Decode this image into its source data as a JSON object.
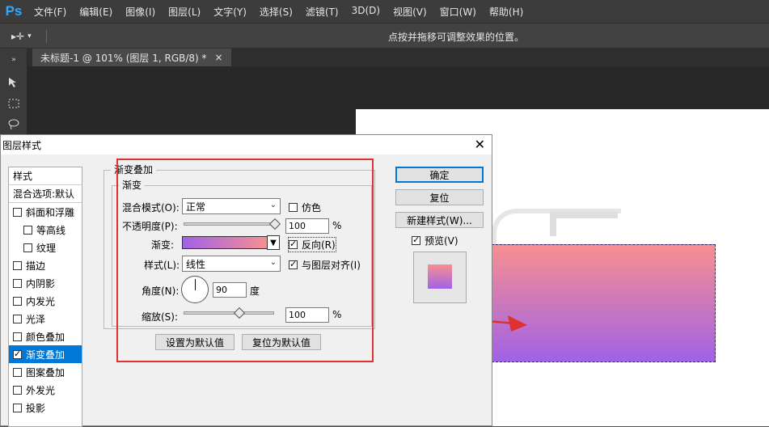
{
  "app": {
    "logo": "Ps"
  },
  "menu": [
    "文件(F)",
    "编辑(E)",
    "图像(I)",
    "图层(L)",
    "文字(Y)",
    "选择(S)",
    "滤镜(T)",
    "3D(D)",
    "视图(V)",
    "窗口(W)",
    "帮助(H)"
  ],
  "options": {
    "hint": "点按并拖移可调整效果的位置。"
  },
  "document": {
    "tab_title": "未标题-1 @ 101% (图层 1, RGB/8) *",
    "tab_close": "×"
  },
  "dialog": {
    "title": "图层样式",
    "close": "✕",
    "styles_header": "样式",
    "blend_default": "混合选项:默认",
    "styles": [
      {
        "label": "斜面和浮雕",
        "checked": false,
        "indent": false
      },
      {
        "label": "等高线",
        "checked": false,
        "indent": true
      },
      {
        "label": "纹理",
        "checked": false,
        "indent": true
      },
      {
        "label": "描边",
        "checked": false,
        "indent": false
      },
      {
        "label": "内阴影",
        "checked": false,
        "indent": false
      },
      {
        "label": "内发光",
        "checked": false,
        "indent": false
      },
      {
        "label": "光泽",
        "checked": false,
        "indent": false
      },
      {
        "label": "颜色叠加",
        "checked": false,
        "indent": false
      },
      {
        "label": "渐变叠加",
        "checked": true,
        "indent": false,
        "selected": true
      },
      {
        "label": "图案叠加",
        "checked": false,
        "indent": false
      },
      {
        "label": "外发光",
        "checked": false,
        "indent": false
      },
      {
        "label": "投影",
        "checked": false,
        "indent": false
      }
    ],
    "section_title": "渐变叠加",
    "sub_title": "渐变",
    "blend_mode_label": "混合模式(O):",
    "blend_mode_value": "正常",
    "dither_label": "仿色",
    "opacity_label": "不透明度(P):",
    "opacity_value": "100",
    "percent": "%",
    "gradient_label": "渐变:",
    "reverse_label": "反向(R)",
    "style_label": "样式(L):",
    "style_value": "线性",
    "align_label": "与图层对齐(I)",
    "angle_label": "角度(N):",
    "angle_value": "90",
    "degree": "度",
    "scale_label": "缩放(S):",
    "scale_value": "100",
    "set_default": "设置为默认值",
    "reset_default": "复位为默认值",
    "ok": "确定",
    "reset": "复位",
    "new_style": "新建样式(W)...",
    "preview_label": "预览(V)"
  },
  "colors": {
    "gradient_start": "#a062e6",
    "gradient_end": "#f78f91",
    "highlight": "#e03030",
    "accent": "#0078d7"
  },
  "values": {
    "opacity_pct": 100,
    "scale_pct": 100,
    "angle_deg": 90
  }
}
